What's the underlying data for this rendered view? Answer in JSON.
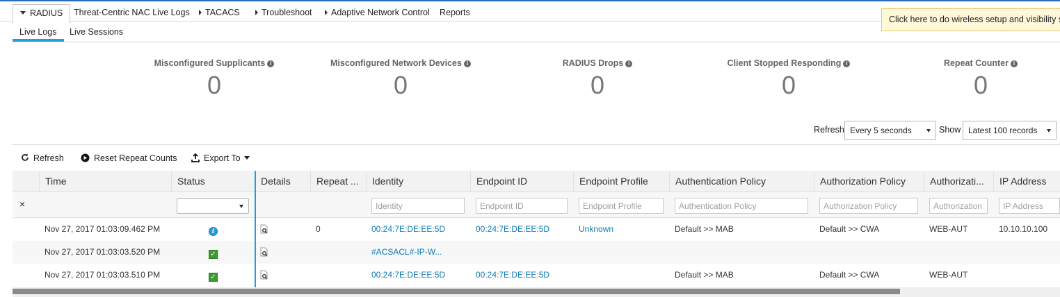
{
  "top_menu": {
    "items": [
      {
        "label": "RADIUS",
        "active": true
      },
      {
        "label": "Threat-Centric NAC Live Logs"
      },
      {
        "label": "TACACS"
      },
      {
        "label": "Troubleshoot"
      },
      {
        "label": "Adaptive Network Control"
      },
      {
        "label": "Reports"
      }
    ]
  },
  "banner": {
    "text": "Click here to do wireless setup and visibility se"
  },
  "sub_tabs": [
    {
      "label": "Live Logs",
      "active": true
    },
    {
      "label": "Live Sessions"
    }
  ],
  "metrics": [
    {
      "label": "Misconfigured Supplicants",
      "value": "0"
    },
    {
      "label": "Misconfigured Network Devices",
      "value": "0"
    },
    {
      "label": "RADIUS Drops",
      "value": "0"
    },
    {
      "label": "Client Stopped Responding",
      "value": "0"
    },
    {
      "label": "Repeat Counter",
      "value": "0"
    }
  ],
  "controls": {
    "refresh_label": "Refresh",
    "refresh_value": "Every 5 seconds",
    "show_label": "Show",
    "show_value": "Latest 100 records"
  },
  "toolbar": {
    "refresh": "Refresh",
    "reset": "Reset Repeat Counts",
    "export": "Export To"
  },
  "table": {
    "columns": [
      "",
      "Time",
      "Status",
      "Details",
      "Repeat ...",
      "Identity",
      "Endpoint ID",
      "Endpoint Profile",
      "Authentication Policy",
      "Authorization Policy",
      "Authorizati...",
      "IP Address"
    ],
    "filter": {
      "clear": "×",
      "identity": "Identity",
      "endpoint_id": "Endpoint ID",
      "endpoint_profile": "Endpoint Profile",
      "auth_policy": "Authentication Policy",
      "authz_policy": "Authorization Policy",
      "authz_profile": "Authorization",
      "ip": "IP Address"
    },
    "rows": [
      {
        "time": "Nov 27, 2017 01:03:09.462 PM",
        "status": "info",
        "repeat": "0",
        "identity": "00:24:7E:DE:EE:5D",
        "endpoint_id": "00:24:7E:DE:EE:5D",
        "profile": "Unknown",
        "auth_policy": "Default >> MAB",
        "authz_policy": "Default >> CWA",
        "authz_profile": "WEB-AUT",
        "ip": "10.10.10.100"
      },
      {
        "time": "Nov 27, 2017 01:03:03.520 PM",
        "status": "ok",
        "repeat": "",
        "identity": "#ACSACL#-IP-W...",
        "endpoint_id": "",
        "profile": "",
        "auth_policy": "",
        "authz_policy": "",
        "authz_profile": "",
        "ip": ""
      },
      {
        "time": "Nov 27, 2017 01:03:03.510 PM",
        "status": "ok",
        "repeat": "",
        "identity": "00:24:7E:DE:EE:5D",
        "endpoint_id": "00:24:7E:DE:EE:5D",
        "profile": "",
        "auth_policy": "Default >> MAB",
        "authz_policy": "Default >> CWA",
        "authz_profile": "WEB-AUT",
        "ip": ""
      }
    ]
  },
  "colors": {
    "accent": "#1ba0d7",
    "link": "#0c7ab4",
    "success": "#3e9b33"
  }
}
